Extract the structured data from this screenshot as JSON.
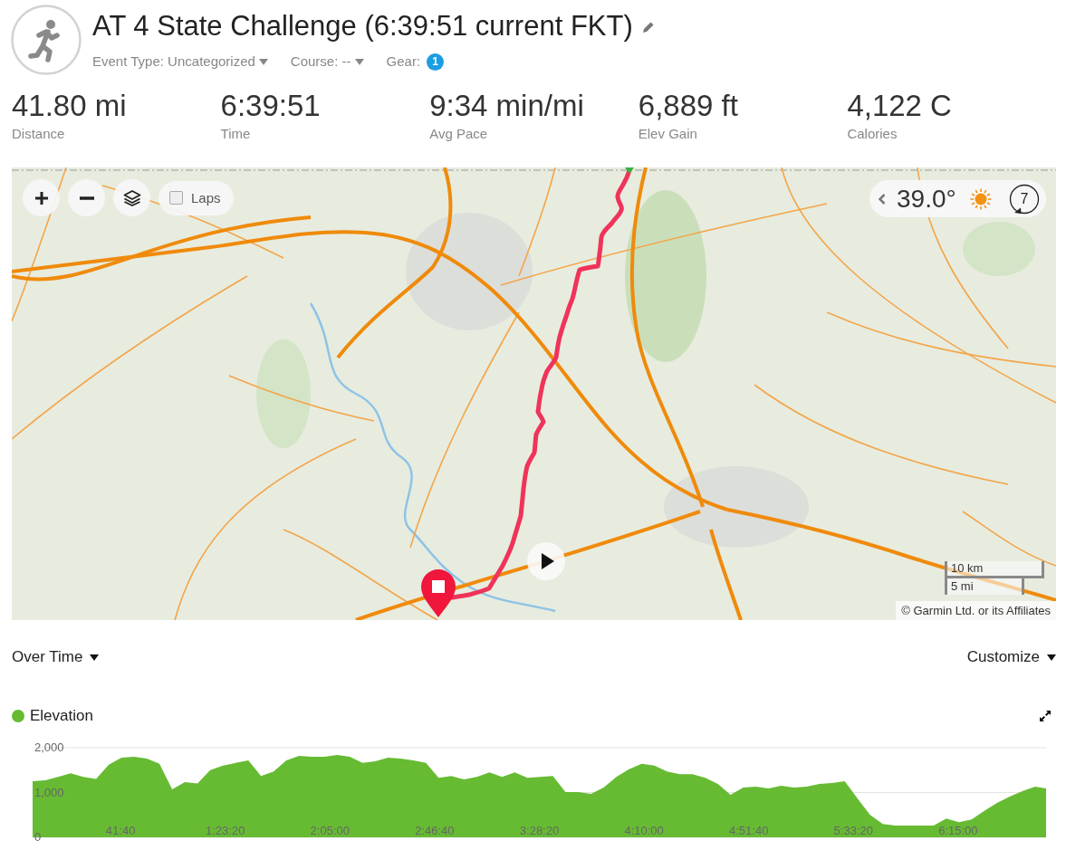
{
  "activity": {
    "title": "AT 4 State Challenge (6:39:51 current FKT)",
    "event_type": "Event Type: Uncategorized",
    "course": "Course: --",
    "gear_label": "Gear:",
    "gear_count": "1"
  },
  "stats": [
    {
      "value": "41.80 mi",
      "label": "Distance"
    },
    {
      "value": "6:39:51",
      "label": "Time"
    },
    {
      "value": "9:34 min/mi",
      "label": "Avg Pace"
    },
    {
      "value": "6,889 ft",
      "label": "Elev Gain"
    },
    {
      "value": "4,122 C",
      "label": "Calories"
    }
  ],
  "map": {
    "laps": {
      "label": "Laps",
      "checked": false
    },
    "weather": {
      "temperature": "39.0°",
      "wind_speed": "7"
    },
    "scale": {
      "metric": "10 km",
      "imperial": "5 mi"
    },
    "attribution": "© Garmin Ltd. or its Affiliates"
  },
  "chart_view": {
    "mode": "Over Time",
    "customize": "Customize"
  },
  "elevation_chart": {
    "chart_data": {
      "type": "area",
      "x": [
        400,
        703,
        1006,
        1309,
        1612,
        1915,
        2218,
        2521,
        2824,
        3127,
        3430,
        3733,
        4036,
        4339,
        4642,
        4945,
        5248,
        5551,
        5854,
        6157,
        6460,
        6763,
        7066,
        7369,
        7672,
        7975,
        8278,
        8581,
        8884,
        9187,
        9490,
        9793,
        10096,
        10399,
        10702,
        11005,
        11308,
        11611,
        11914,
        12217,
        12520,
        12823,
        13126,
        13429,
        13732,
        14035,
        14338,
        14641,
        14944,
        15247,
        15550,
        15853,
        16156,
        16459,
        16762,
        17065,
        17368,
        17671,
        17974,
        18277,
        18580,
        18883,
        19186,
        19489,
        19792,
        20095,
        20398,
        20701,
        21004,
        21307,
        21610,
        21913,
        22216,
        22519,
        22822,
        23125,
        23428,
        23731,
        24034,
        24337,
        24600
      ],
      "series": [
        {
          "name": "Elevation",
          "color": "#66bb33",
          "values": [
            1250,
            1270,
            1350,
            1430,
            1350,
            1300,
            1620,
            1780,
            1800,
            1760,
            1640,
            1070,
            1230,
            1200,
            1500,
            1600,
            1660,
            1720,
            1370,
            1470,
            1720,
            1820,
            1800,
            1800,
            1840,
            1800,
            1660,
            1700,
            1780,
            1760,
            1720,
            1660,
            1330,
            1370,
            1290,
            1350,
            1450,
            1350,
            1450,
            1330,
            1350,
            1370,
            1010,
            1010,
            970,
            1110,
            1350,
            1520,
            1640,
            1600,
            1470,
            1410,
            1410,
            1330,
            1190,
            950,
            1110,
            1130,
            1090,
            1150,
            1110,
            1130,
            1190,
            1210,
            1250,
            870,
            500,
            300,
            260,
            260,
            260,
            260,
            420,
            340,
            400,
            590,
            770,
            910,
            1030,
            1130,
            1090
          ]
        }
      ],
      "xlim": [
        400,
        24600
      ],
      "ylim": [
        0,
        2000
      ],
      "xticks": [
        {
          "value": 2500,
          "label": "41:40"
        },
        {
          "value": 5000,
          "label": "1:23:20"
        },
        {
          "value": 7500,
          "label": "2:05:00"
        },
        {
          "value": 10000,
          "label": "2:46:40"
        },
        {
          "value": 12500,
          "label": "3:28:20"
        },
        {
          "value": 15000,
          "label": "4:10:00"
        },
        {
          "value": 17500,
          "label": "4:51:40"
        },
        {
          "value": 20000,
          "label": "5:33:20"
        },
        {
          "value": 22500,
          "label": "6:15:00"
        }
      ],
      "yticks": [
        {
          "value": 0,
          "label": "0"
        },
        {
          "value": 1000,
          "label": "1,000"
        },
        {
          "value": 2000,
          "label": "2,000"
        }
      ]
    }
  }
}
